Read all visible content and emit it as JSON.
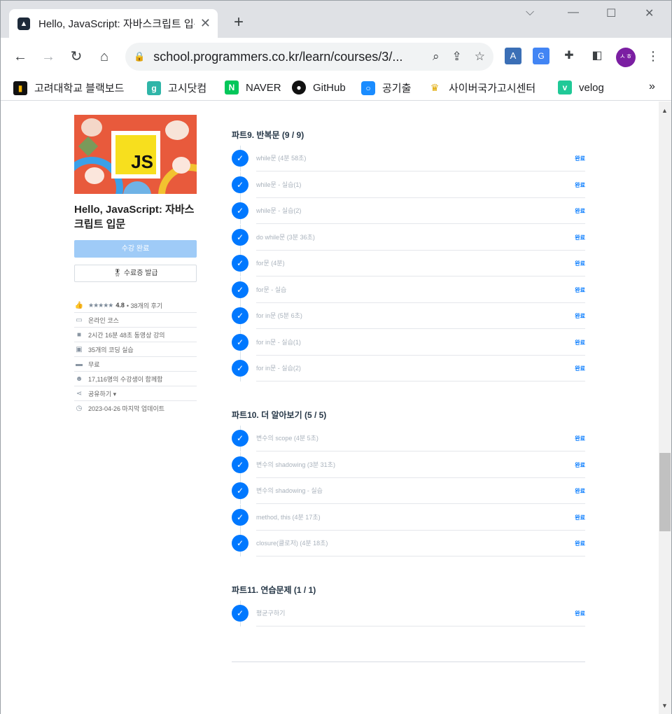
{
  "browser": {
    "tab_title": "Hello, JavaScript: 자바스크립트 입문",
    "url": "school.programmers.co.kr/learn/courses/3/...",
    "avatar_text": "ㅅㅎ",
    "bookmarks": [
      {
        "label": "고려대학교 블랙보드",
        "icon": "bar-chart-icon"
      },
      {
        "label": "고시닷컴",
        "icon": "g-icon"
      },
      {
        "label": "NAVER",
        "icon": "naver-icon"
      },
      {
        "label": "GitHub",
        "icon": "github-icon"
      },
      {
        "label": "공기출",
        "icon": "circle-icon"
      },
      {
        "label": "사이버국가고시센터",
        "icon": "crown-icon"
      },
      {
        "label": "velog",
        "icon": "v-icon"
      }
    ],
    "bookmarks_more": "»"
  },
  "course": {
    "logo_text": "JS",
    "title": "Hello, JavaScript: 자바스크립트 입문",
    "done_button": "수강 완료",
    "cert_button": "수료증 발급",
    "rating_stars": "★★★★★",
    "rating": "4.8",
    "reviews": "• 38개의 후기",
    "info": [
      {
        "icon": "laptop-icon",
        "text": "온라인 코스"
      },
      {
        "icon": "video-icon",
        "text": "2시간 16분 48초 동영상 강의"
      },
      {
        "icon": "code-icon",
        "text": "35개의 코딩 실습"
      },
      {
        "icon": "card-icon",
        "text": "무료"
      },
      {
        "icon": "people-icon",
        "text": "17,116명의 수강생이 함께함"
      },
      {
        "icon": "share-icon",
        "text": "공유하기 ▾"
      },
      {
        "icon": "clock-icon",
        "text": "2023-04-26 마지막 업데이트"
      }
    ]
  },
  "parts": [
    {
      "title": "파트9. 반복문 (9 / 9)",
      "lessons": [
        {
          "name": "while문 (4분 58초)",
          "status": "완료"
        },
        {
          "name": "while문 - 실습(1)",
          "status": "완료"
        },
        {
          "name": "while문 - 실습(2)",
          "status": "완료"
        },
        {
          "name": "do while문 (3분 36초)",
          "status": "완료"
        },
        {
          "name": "for문 (4분)",
          "status": "완료"
        },
        {
          "name": "for문 - 실습",
          "status": "완료"
        },
        {
          "name": "for in문 (5분 6초)",
          "status": "완료"
        },
        {
          "name": "for in문 - 실습(1)",
          "status": "완료"
        },
        {
          "name": "for in문 - 실습(2)",
          "status": "완료"
        }
      ]
    },
    {
      "title": "파트10. 더 알아보기 (5 / 5)",
      "lessons": [
        {
          "name": "변수의 scope (4분 5초)",
          "status": "완료"
        },
        {
          "name": "변수의 shadowing (3분 31초)",
          "status": "완료"
        },
        {
          "name": "변수의 shadowing - 실습",
          "status": "완료"
        },
        {
          "name": "method, this (4분 17초)",
          "status": "완료"
        },
        {
          "name": "closure(클로저) (4분 18초)",
          "status": "완료"
        }
      ]
    },
    {
      "title": "파트11. 연습문제 (1 / 1)",
      "lessons": [
        {
          "name": "평균구하기",
          "status": "완료"
        }
      ]
    }
  ],
  "colors": {
    "accent": "#0078ff",
    "done_button": "#9fcbf7",
    "js_yellow": "#f7df1e"
  }
}
